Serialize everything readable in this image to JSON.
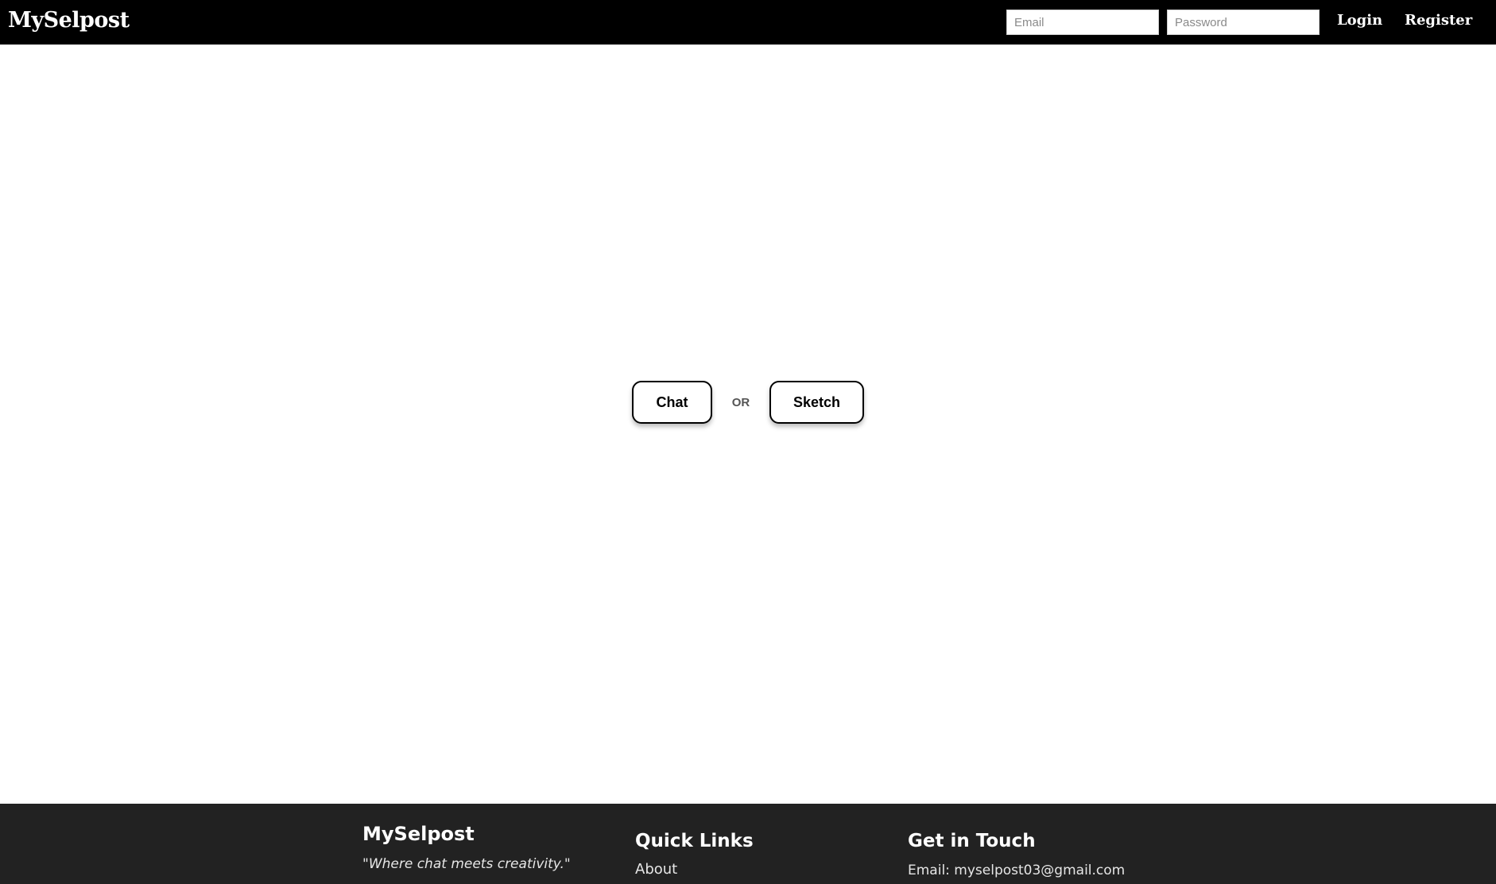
{
  "navbar": {
    "brand": "MySelpost",
    "email_placeholder": "Email",
    "password_placeholder": "Password",
    "login_label": "Login",
    "register_label": "Register"
  },
  "main": {
    "chat_label": "Chat",
    "or_label": "OR",
    "sketch_label": "Sketch"
  },
  "footer": {
    "brand": "MySelpost",
    "tagline": "\"Where chat meets creativity.\"",
    "quick_links_heading": "Quick Links",
    "quick_links": [
      "About"
    ],
    "contact_heading": "Get in Touch",
    "contact_email": "Email: myselpost03@gmail.com"
  },
  "colors": {
    "navbar_bg": "#000000",
    "footer_bg": "#222222",
    "page_bg": "#ffffff"
  }
}
